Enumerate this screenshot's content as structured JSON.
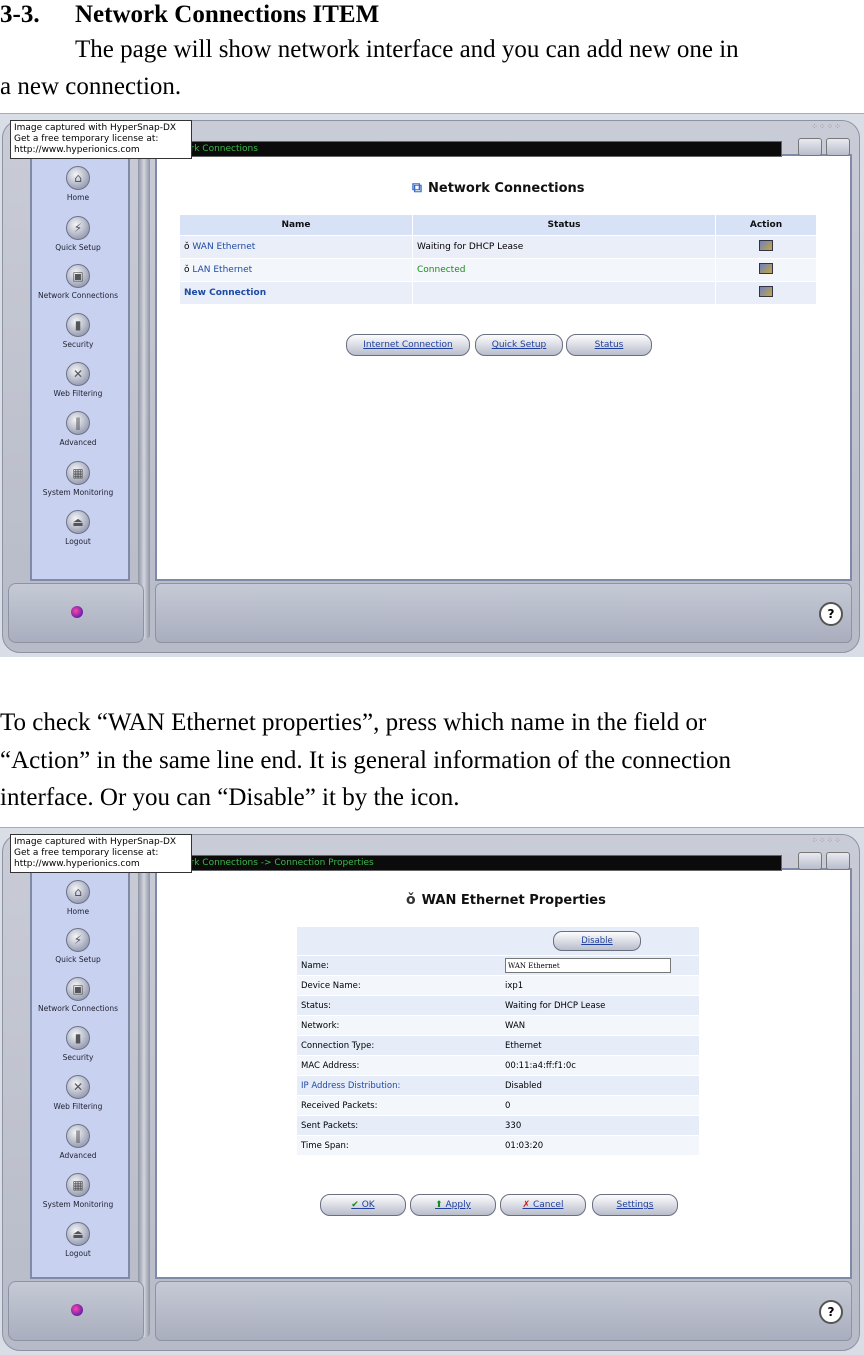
{
  "heading": {
    "number": "3-3.",
    "title": "Network Connections ITEM"
  },
  "intro": {
    "line1": "The page will show network interface and you can add new one in",
    "line2": "a new connection."
  },
  "paragraph": {
    "line1": "To check “WAN Ethernet properties”, press which name in the field or",
    "line2": "“Action” in the same line end. It is general information of the connection",
    "line3": "interface. Or you can “Disable” it by the icon."
  },
  "watermark": {
    "line1": "Image captured with HyperSnap-DX",
    "line2": "Get a free temporary license at:",
    "line3": "http://www.hyperionics.com"
  },
  "nav": {
    "home": "Home",
    "quick_setup": "Quick Setup",
    "network_connections": "Network Connections",
    "security": "Security",
    "web_filtering": "Web Filtering",
    "advanced": "Advanced",
    "system_monitoring": "System Monitoring",
    "logout": "Logout"
  },
  "shot1": {
    "breadcrumb": "ork Connections",
    "page_title": "Network Connections",
    "table": {
      "headers": {
        "name": "Name",
        "status": "Status",
        "action": "Action"
      },
      "rows": [
        {
          "name": "WAN Ethernet",
          "status": "Waiting for DHCP Lease"
        },
        {
          "name": "LAN Ethernet",
          "status": "Connected"
        },
        {
          "name": "New Connection",
          "status": ""
        }
      ]
    },
    "buttons": {
      "internet": "Internet Connection",
      "quick_setup": "Quick Setup",
      "status": "Status"
    }
  },
  "shot2": {
    "breadcrumb": "ork Connections -> Connection Properties",
    "page_title": "WAN Ethernet Properties",
    "disable_button": "Disable",
    "name_label": "Name:",
    "name_value": "WAN Ethernet",
    "rows": [
      {
        "label": "Device Name:",
        "value": "ixp1"
      },
      {
        "label": "Status:",
        "value": "Waiting for DHCP Lease"
      },
      {
        "label": "Network:",
        "value": "WAN"
      },
      {
        "label": "Connection Type:",
        "value": "Ethernet"
      },
      {
        "label": "MAC Address:",
        "value": "00:11:a4:ff:f1:0c"
      },
      {
        "label": "IP Address Distribution:",
        "value": "Disabled"
      },
      {
        "label": "Received Packets:",
        "value": "0"
      },
      {
        "label": "Sent Packets:",
        "value": "330"
      },
      {
        "label": "Time Span:",
        "value": "01:03:20"
      }
    ],
    "buttons": {
      "ok": "OK",
      "apply": "Apply",
      "cancel": "Cancel",
      "settings": "Settings"
    }
  }
}
